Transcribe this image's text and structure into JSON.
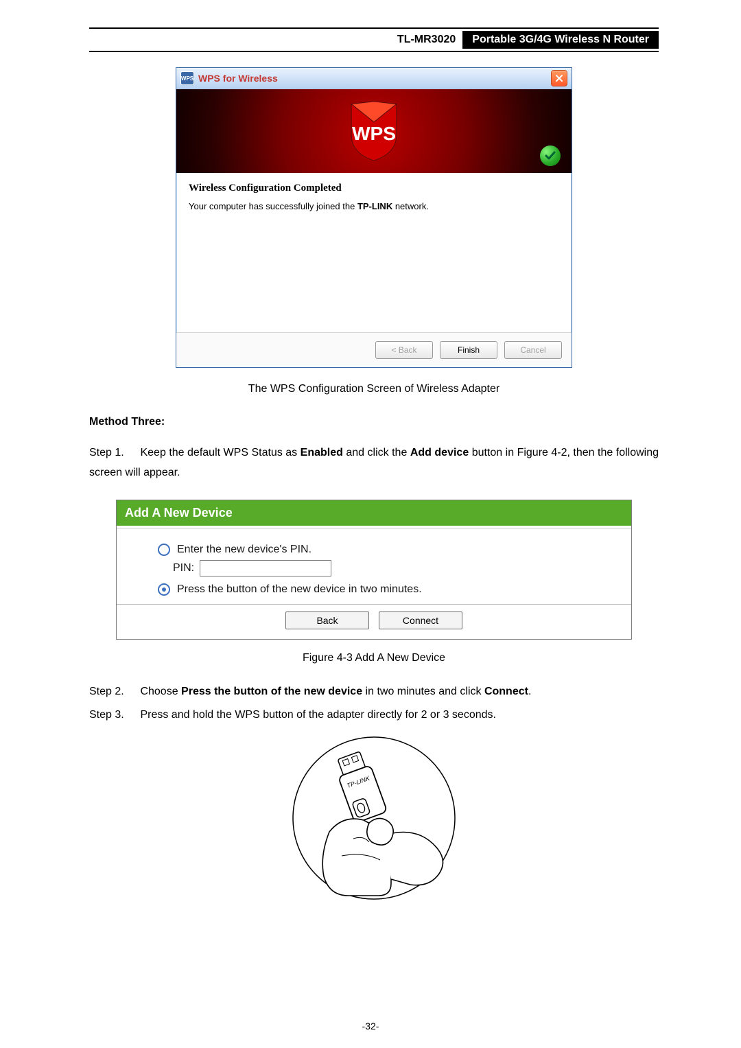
{
  "header": {
    "model": "TL-MR3020",
    "description": "Portable 3G/4G Wireless N Router"
  },
  "wps_window": {
    "title": "WPS for Wireless",
    "banner_text": "WPS",
    "status_title": "Wireless Configuration Completed",
    "status_pre": "Your computer has successfully joined the ",
    "status_bold": "TP-LINK",
    "status_post": " network.",
    "buttons": {
      "back": "< Back",
      "finish": "Finish",
      "cancel": "Cancel"
    }
  },
  "caption1": "The WPS Configuration Screen of Wireless Adapter",
  "method_heading": "Method Three:",
  "steps": {
    "s1_label": "Step 1.",
    "s1_a": "Keep the default WPS Status as ",
    "s1_b": "Enabled",
    "s1_c": " and click the ",
    "s1_d": "Add device",
    "s1_e": " button in Figure 4-2, then the following screen will appear.",
    "s2_label": "Step 2.",
    "s2_a": "Choose ",
    "s2_b": "Press the button of the new device",
    "s2_c": " in two minutes and click ",
    "s2_d": "Connect",
    "s2_e": ".",
    "s3_label": "Step 3.",
    "s3_text": "Press and hold the WPS button of the adapter directly for 2 or 3 seconds."
  },
  "add_panel": {
    "title": "Add A New Device",
    "option_pin": "Enter the new device's PIN.",
    "pin_label": "PIN:",
    "option_button": "Press the button of the new device in two minutes.",
    "back": "Back",
    "connect": "Connect"
  },
  "figure_caption": "Figure 4-3    Add A New Device",
  "adapter_label": "TP-LINK",
  "page_number": "-32-"
}
